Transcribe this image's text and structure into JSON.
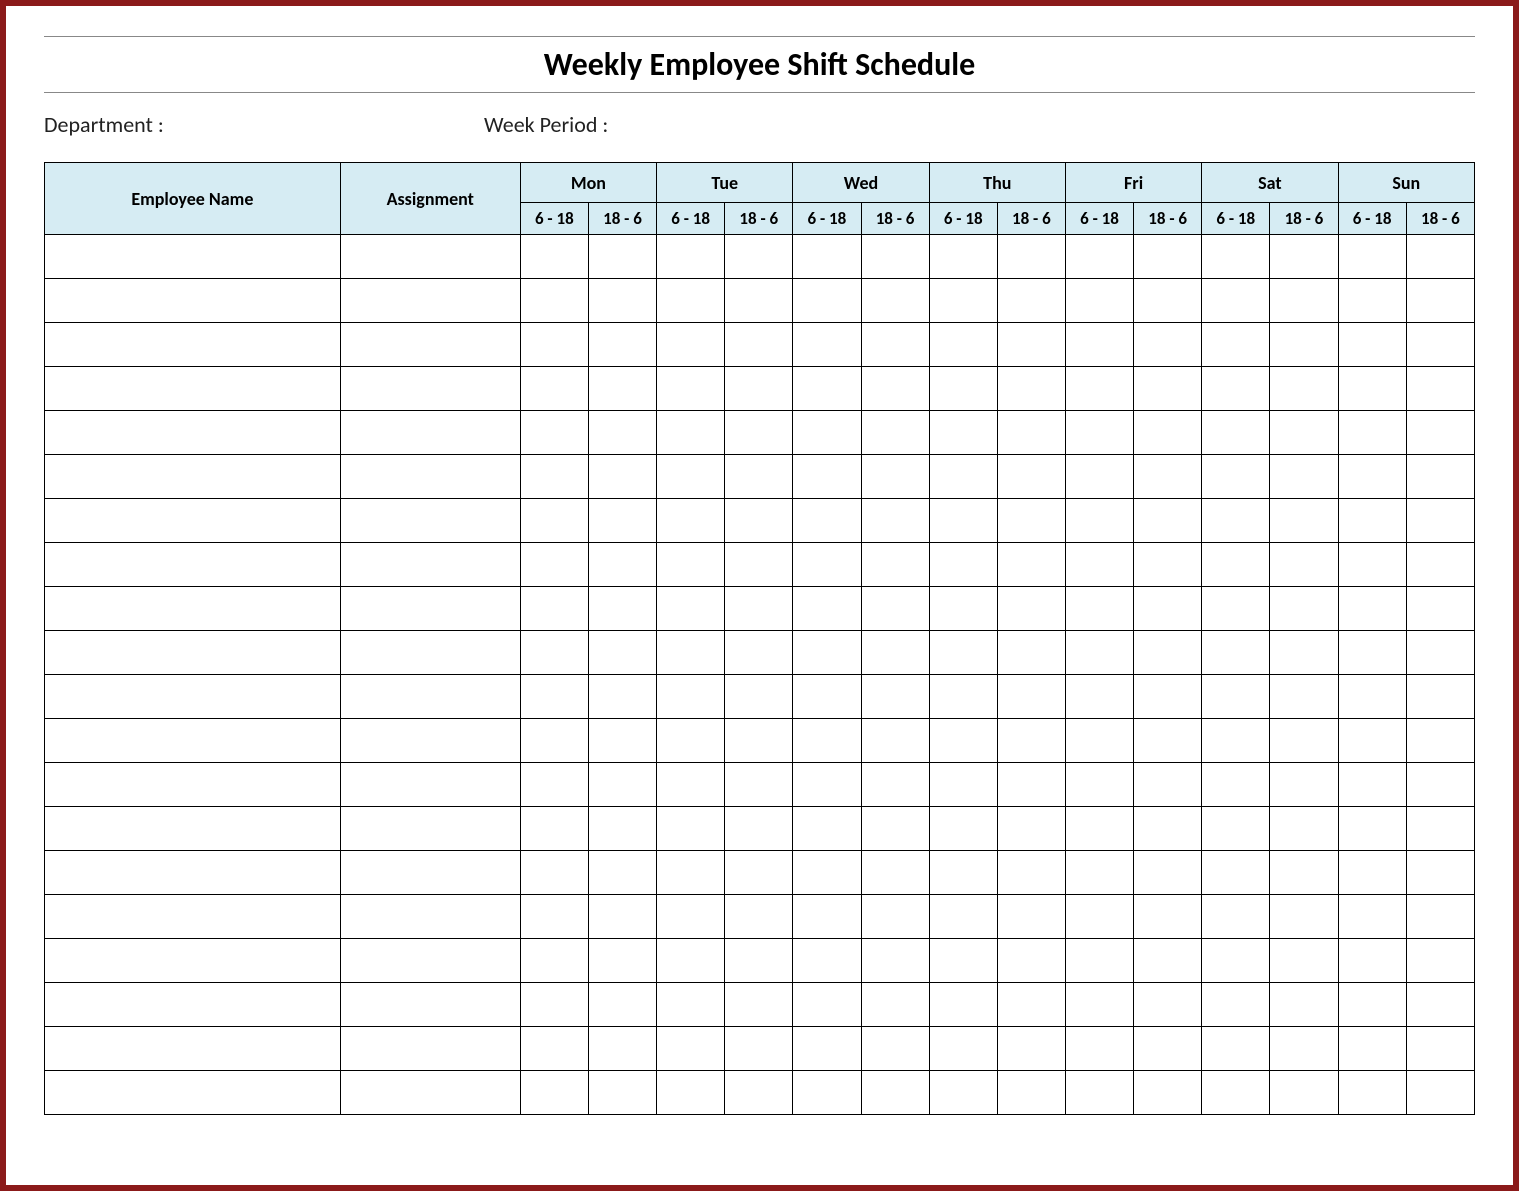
{
  "title": "Weekly Employee Shift Schedule",
  "meta": {
    "department_label": "Department :",
    "week_label": "Week  Period :"
  },
  "headers": {
    "employee": "Employee Name",
    "assignment": "Assignment",
    "days": [
      "Mon",
      "Tue",
      "Wed",
      "Thu",
      "Fri",
      "Sat",
      "Sun"
    ],
    "shift1": "6 - 18",
    "shift2": "18 - 6"
  },
  "rows": [
    {
      "name": "",
      "assignment": "",
      "cells": [
        "",
        "",
        "",
        "",
        "",
        "",
        "",
        "",
        "",
        "",
        "",
        "",
        "",
        ""
      ]
    },
    {
      "name": "",
      "assignment": "",
      "cells": [
        "",
        "",
        "",
        "",
        "",
        "",
        "",
        "",
        "",
        "",
        "",
        "",
        "",
        ""
      ]
    },
    {
      "name": "",
      "assignment": "",
      "cells": [
        "",
        "",
        "",
        "",
        "",
        "",
        "",
        "",
        "",
        "",
        "",
        "",
        "",
        ""
      ]
    },
    {
      "name": "",
      "assignment": "",
      "cells": [
        "",
        "",
        "",
        "",
        "",
        "",
        "",
        "",
        "",
        "",
        "",
        "",
        "",
        ""
      ]
    },
    {
      "name": "",
      "assignment": "",
      "cells": [
        "",
        "",
        "",
        "",
        "",
        "",
        "",
        "",
        "",
        "",
        "",
        "",
        "",
        ""
      ]
    },
    {
      "name": "",
      "assignment": "",
      "cells": [
        "",
        "",
        "",
        "",
        "",
        "",
        "",
        "",
        "",
        "",
        "",
        "",
        "",
        ""
      ]
    },
    {
      "name": "",
      "assignment": "",
      "cells": [
        "",
        "",
        "",
        "",
        "",
        "",
        "",
        "",
        "",
        "",
        "",
        "",
        "",
        ""
      ]
    },
    {
      "name": "",
      "assignment": "",
      "cells": [
        "",
        "",
        "",
        "",
        "",
        "",
        "",
        "",
        "",
        "",
        "",
        "",
        "",
        ""
      ]
    },
    {
      "name": "",
      "assignment": "",
      "cells": [
        "",
        "",
        "",
        "",
        "",
        "",
        "",
        "",
        "",
        "",
        "",
        "",
        "",
        ""
      ]
    },
    {
      "name": "",
      "assignment": "",
      "cells": [
        "",
        "",
        "",
        "",
        "",
        "",
        "",
        "",
        "",
        "",
        "",
        "",
        "",
        ""
      ]
    },
    {
      "name": "",
      "assignment": "",
      "cells": [
        "",
        "",
        "",
        "",
        "",
        "",
        "",
        "",
        "",
        "",
        "",
        "",
        "",
        ""
      ]
    },
    {
      "name": "",
      "assignment": "",
      "cells": [
        "",
        "",
        "",
        "",
        "",
        "",
        "",
        "",
        "",
        "",
        "",
        "",
        "",
        ""
      ]
    },
    {
      "name": "",
      "assignment": "",
      "cells": [
        "",
        "",
        "",
        "",
        "",
        "",
        "",
        "",
        "",
        "",
        "",
        "",
        "",
        ""
      ]
    },
    {
      "name": "",
      "assignment": "",
      "cells": [
        "",
        "",
        "",
        "",
        "",
        "",
        "",
        "",
        "",
        "",
        "",
        "",
        "",
        ""
      ]
    },
    {
      "name": "",
      "assignment": "",
      "cells": [
        "",
        "",
        "",
        "",
        "",
        "",
        "",
        "",
        "",
        "",
        "",
        "",
        "",
        ""
      ]
    },
    {
      "name": "",
      "assignment": "",
      "cells": [
        "",
        "",
        "",
        "",
        "",
        "",
        "",
        "",
        "",
        "",
        "",
        "",
        "",
        ""
      ]
    },
    {
      "name": "",
      "assignment": "",
      "cells": [
        "",
        "",
        "",
        "",
        "",
        "",
        "",
        "",
        "",
        "",
        "",
        "",
        "",
        ""
      ]
    },
    {
      "name": "",
      "assignment": "",
      "cells": [
        "",
        "",
        "",
        "",
        "",
        "",
        "",
        "",
        "",
        "",
        "",
        "",
        "",
        ""
      ]
    },
    {
      "name": "",
      "assignment": "",
      "cells": [
        "",
        "",
        "",
        "",
        "",
        "",
        "",
        "",
        "",
        "",
        "",
        "",
        "",
        ""
      ]
    },
    {
      "name": "",
      "assignment": "",
      "cells": [
        "",
        "",
        "",
        "",
        "",
        "",
        "",
        "",
        "",
        "",
        "",
        "",
        "",
        ""
      ]
    }
  ]
}
